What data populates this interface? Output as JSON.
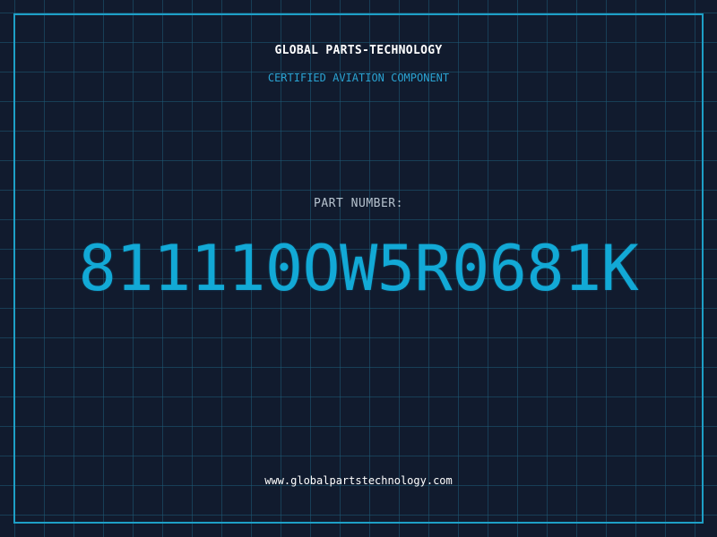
{
  "header": {
    "company": "GLOBAL PARTS-TECHNOLOGY",
    "tagline": "CERTIFIED AVIATION COMPONENT"
  },
  "part": {
    "label": "PART NUMBER:",
    "number": "811110OW5R0681K"
  },
  "footer": {
    "url": "www.globalpartstechnology.com"
  },
  "colors": {
    "background": "#111b2e",
    "grid": "#1e5c76",
    "frame": "#1e9fc6",
    "accent": "#12a9d6",
    "label": "#b7c3cf"
  }
}
